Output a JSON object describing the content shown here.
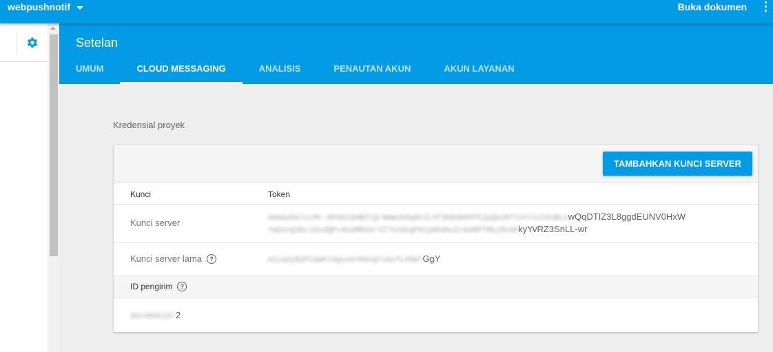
{
  "topbar": {
    "project_name": "webpushnotif",
    "docs_link": "Buka dokumen"
  },
  "header": {
    "title": "Setelan",
    "tabs": [
      {
        "label": "UMUM",
        "active": false
      },
      {
        "label": "CLOUD MESSAGING",
        "active": true
      },
      {
        "label": "ANALISIS",
        "active": false
      },
      {
        "label": "PENAUTAN AKUN",
        "active": false
      },
      {
        "label": "AKUN LAYANAN",
        "active": false
      }
    ]
  },
  "content": {
    "section_label": "Kredensial proyek",
    "add_button": "TAMBAHKAN KUNCI SERVER",
    "columns": {
      "key": "Kunci",
      "token": "Token"
    },
    "rows": [
      {
        "label": "Kunci server",
        "token_line1_blurred": "AAAAdXk7cLMr:APA91bHBZtQr9mWvkDq8hJL4f3K8aN9XfE2pQ0sR7tVxY1uI6oBLk",
        "token_line1_visible": "wQqDTIZ3L8ggdEUNV0HxW",
        "token_line2_blurred": "YmDxnQ3bLtDsdQPv4UaMRk6rYZ7hn5kqP6tpNXdAuZcGd8PTMbjRnd8",
        "token_line2_visible": "kyYvRZ3SnLL-wr"
      },
      {
        "label": "Kunci server lama",
        "help": "?",
        "token_blurred": "AIzaSyBZPIaWhT4gsoeYKHvQ7xdsfLX8W7",
        "token_visible": "GgY"
      }
    ],
    "sender": {
      "label": "ID pengirim",
      "help": "?",
      "value_blurred": "9014695187",
      "value_visible": "2"
    }
  },
  "colors": {
    "primary": "#039be5",
    "background": "#eeeeee",
    "card": "#ffffff"
  },
  "icons": {
    "settings": "gear-icon",
    "project_menu": "chevron-down-icon",
    "more": "more-vert-icon",
    "help": "help-circle-icon"
  }
}
